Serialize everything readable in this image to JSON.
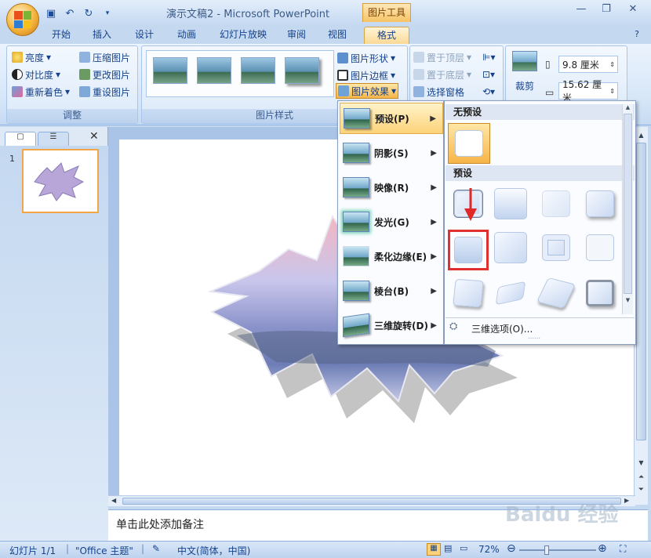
{
  "window": {
    "title": "演示文稿2 - Microsoft PowerPoint",
    "context_tool": "图片工具"
  },
  "tabs": [
    "开始",
    "插入",
    "设计",
    "动画",
    "幻灯片放映",
    "审阅",
    "视图",
    "格式"
  ],
  "active_tab": "格式",
  "ribbon": {
    "adjust": {
      "label": "调整",
      "items": [
        "亮度",
        "对比度",
        "重新着色",
        "压缩图片",
        "更改图片",
        "重设图片"
      ]
    },
    "picture_styles": {
      "label": "图片样式",
      "items": [
        "图片形状",
        "图片边框",
        "图片效果"
      ]
    },
    "arrange": {
      "items": [
        "置于顶层",
        "置于底层",
        "选择窗格"
      ]
    },
    "size": {
      "crop_label": "裁剪",
      "height": "9.8 厘米",
      "width": "15.62 厘米"
    }
  },
  "effects_menu": {
    "items": [
      "预设(P)",
      "阴影(S)",
      "映像(R)",
      "发光(G)",
      "柔化边缘(E)",
      "棱台(B)",
      "三维旋转(D)"
    ],
    "active": "预设(P)"
  },
  "preset_submenu": {
    "no_preset_header": "无预设",
    "preset_header": "预设",
    "options_link": "三维选项(O)...",
    "ellipsis": "⋯⋯"
  },
  "slide_panel": {
    "slide_number": "1"
  },
  "notes": {
    "placeholder": "单击此处添加备注"
  },
  "status": {
    "slide": "幻灯片 1/1",
    "theme": "\"Office 主题\"",
    "language": "中文(简体，中国)",
    "zoom": "72%"
  },
  "colors": {
    "accent": "#f6c365",
    "ribbon": "#dbe9f9",
    "highlight": "#e03030"
  },
  "watermark": "Baidu 经验 jingyan.baidu.com"
}
